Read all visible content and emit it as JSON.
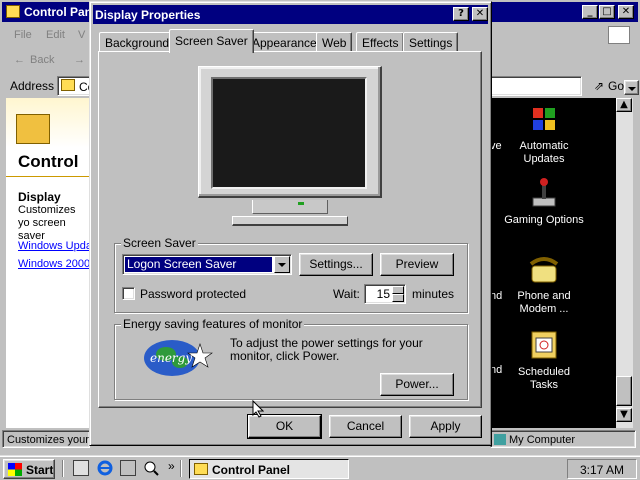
{
  "background_window": {
    "title": "Control Pan",
    "menu": [
      "File",
      "Edit",
      "V"
    ],
    "toolbar_back": "Back",
    "address_label": "Address",
    "address_value": "Co",
    "go_label": "Go",
    "left_heading": "Control",
    "left_item_title": "Display",
    "left_item_desc": "Customizes yo screen saver",
    "links": [
      "Windows Upda",
      "Windows 2000"
    ],
    "status_left": "Customizes your",
    "status_right": "My Computer",
    "icons": [
      {
        "label": "Automatic Updates",
        "icon": "windows-flag-icon"
      },
      {
        "label": "Gaming Options",
        "icon": "joystick-icon"
      },
      {
        "label": "Phone and Modem ...",
        "icon": "telephone-icon"
      },
      {
        "label": "Scheduled Tasks",
        "icon": "scheduled-tasks-icon"
      }
    ],
    "stray_text": [
      "ve",
      "nd",
      "nd"
    ]
  },
  "dialog": {
    "title": "Display Properties",
    "help_btn": "?",
    "close_btn": "✕",
    "tabs": [
      "Background",
      "Screen Saver",
      "Appearance",
      "Web",
      "Effects",
      "Settings"
    ],
    "active_tab": "Screen Saver",
    "screensaver_group": "Screen Saver",
    "screensaver_selected": "Logon Screen Saver",
    "settings_btn": "Settings...",
    "preview_btn": "Preview",
    "password_label": "Password protected",
    "password_checked": false,
    "wait_label": "Wait:",
    "wait_value": "15",
    "minutes_label": "minutes",
    "energy_group": "Energy saving features of monitor",
    "energy_text": "To adjust the power settings for your monitor, click Power.",
    "energy_logo_text": "energy",
    "power_btn": "Power...",
    "ok_btn": "OK",
    "cancel_btn": "Cancel",
    "apply_btn": "Apply"
  },
  "taskbar": {
    "start": "Start",
    "quicklaunch": [
      "desktop-icon",
      "ie-icon",
      "network-icon",
      "search-icon"
    ],
    "chevron": "»",
    "task": "Control Panel",
    "clock": "3:17 AM"
  },
  "colors": {
    "titlebar": "#000080",
    "face": "#c0c0c0",
    "desktop": "#000000",
    "link": "#0000ff"
  }
}
